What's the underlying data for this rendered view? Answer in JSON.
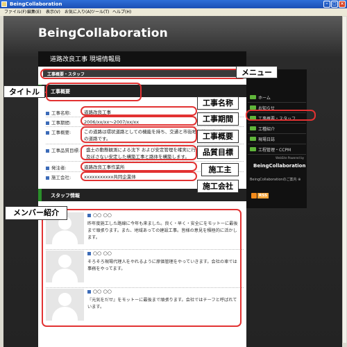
{
  "window": {
    "title": "BeingCollaboration",
    "menu": [
      "ファイル(F)",
      "編集(E)",
      "表示(V)",
      "お気に入り(A)",
      "ツール(T)",
      "ヘルプ(H)"
    ]
  },
  "site": {
    "logo": "BeingCollaboration",
    "page_heading": "道路改良工事 現場情報局",
    "breadcrumb": "工事概要・スタッフ"
  },
  "overview": {
    "section_title": "工事概要",
    "fields": [
      {
        "label": "工事名称:",
        "value": "道路改良工事"
      },
      {
        "label": "工事期間:",
        "value": "2006/xx/xx〜2007/xx/xx"
      },
      {
        "label": "工事概要:",
        "value": "この道路は環状道路としての機能を持ち、交通と市街地を結ぶ延長約8.0kmの道路です。"
      },
      {
        "label": "工事品質目標:",
        "value": "盛土の動態観測による沈下 および安定管理を確実に行い、周辺への影響を及ぼさない安定した構築工事と路体を構築します。"
      },
      {
        "label": "発注者:",
        "value": "道路改良工事作業所"
      },
      {
        "label": "施工会社:",
        "value": "xxxxxxxxxxx共同企業体"
      }
    ]
  },
  "staff": {
    "section_title": "スタッフ情報",
    "members": [
      {
        "name": "○○ ○○",
        "description": "昨年度施工した路線に今年も来ました。良く・早く・安全にをモットーに最後まで頑張ります。また、地域あっての建設工事。皆様の意見を積極的に活かします。"
      },
      {
        "name": "○○ ○○",
        "description": "そろそろ現場代理人をやれるように原価管理をやっていきます。会社の車では事務をやってます。"
      },
      {
        "name": "○○ ○○",
        "description": "『元気をだせ』をモットーに最後まで頑張ります。会社ではチーフと呼ばれています。"
      }
    ]
  },
  "sidebar": {
    "nav": [
      "ホーム",
      "お知らせ",
      "工事概要・スタッフ",
      "工種紹介",
      "現場日誌",
      "工程管理・CCPM"
    ],
    "powered_small": "WebSite Powered by",
    "powered_big": "BeingCollaboration",
    "guide": "BeingCollaborationのご案内 ⊕",
    "rss": "RSS"
  },
  "annotations": {
    "menu": "メニュー",
    "title": "タイトル",
    "project_name": "工事名称",
    "period": "工事期間",
    "summary": "工事概要",
    "quality": "品質目標",
    "client": "施工主",
    "contractor": "施工会社",
    "members": "メンバー紹介"
  },
  "colors": {
    "annotation": "#e23232",
    "accent_green": "#2a8f2a",
    "bullet_blue": "#3c6bb8"
  }
}
